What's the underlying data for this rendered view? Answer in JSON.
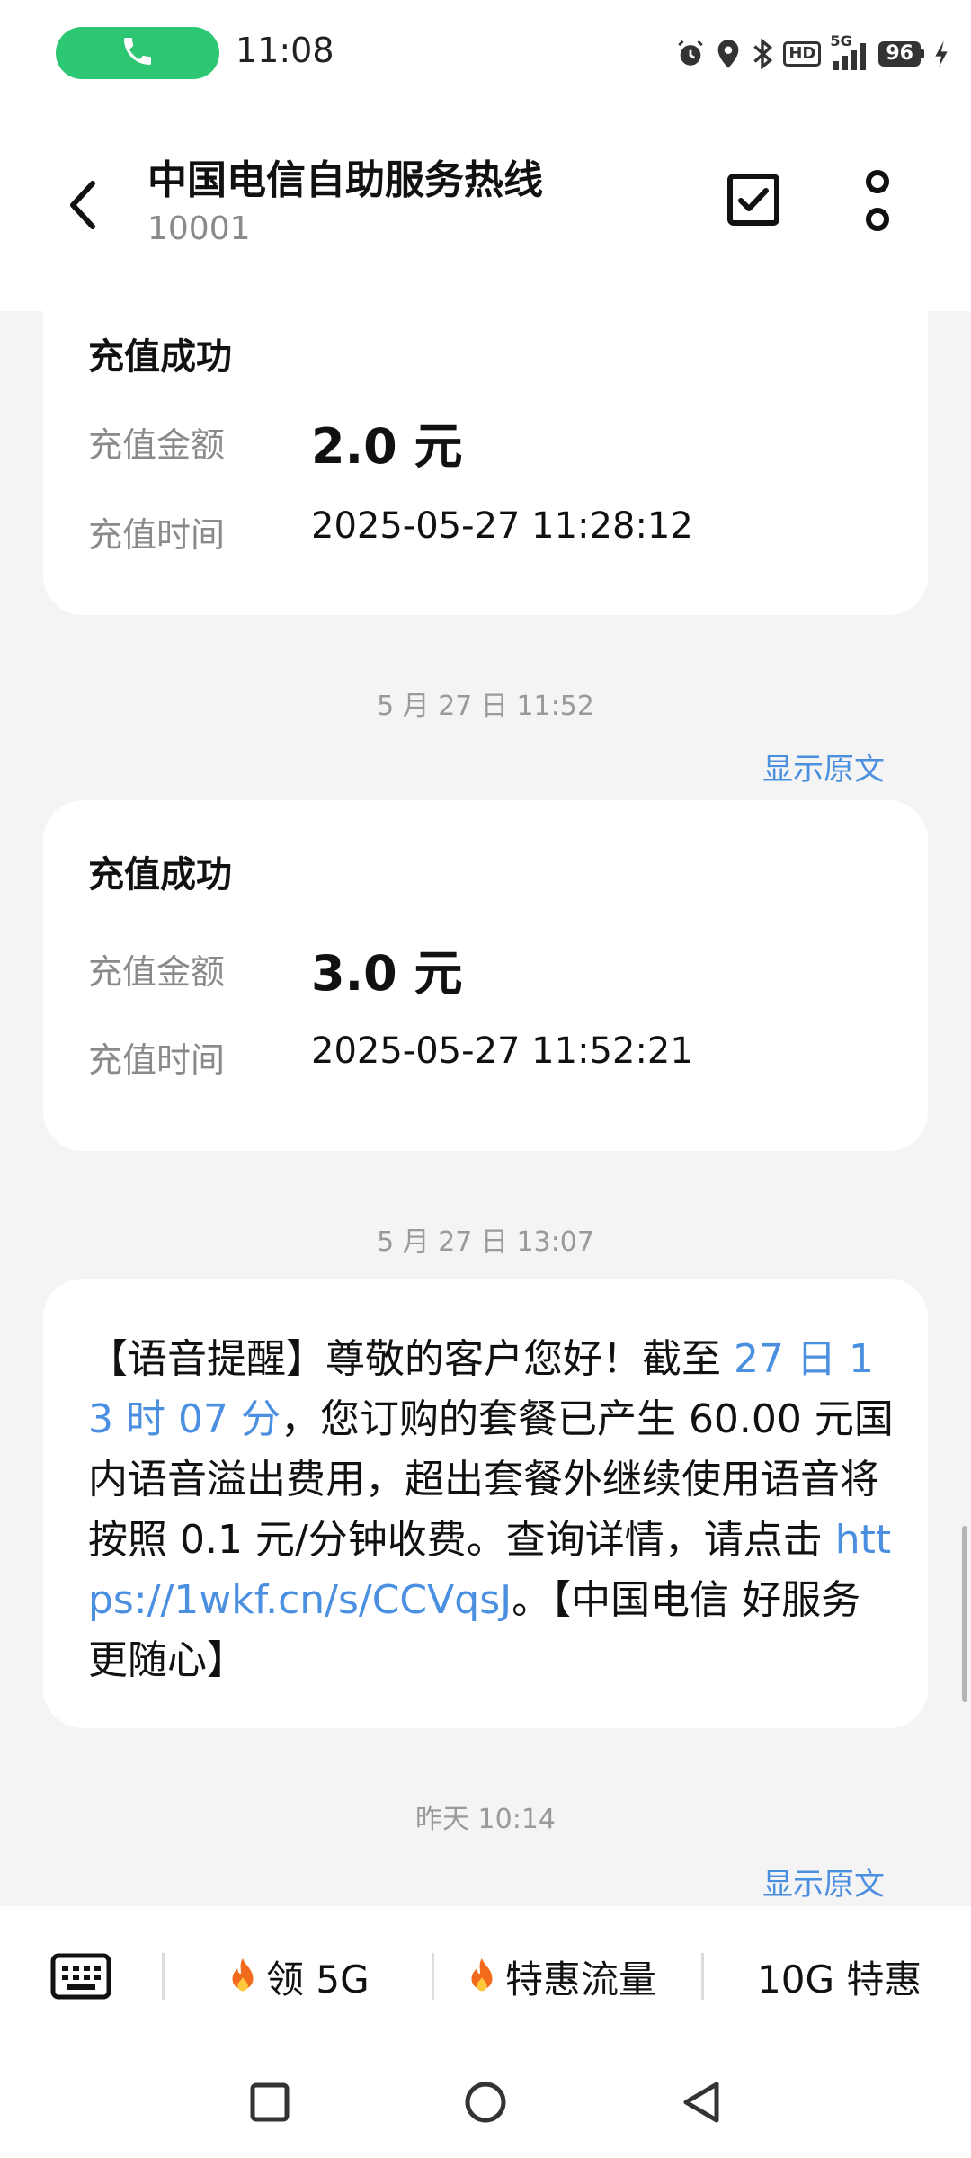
{
  "status_bar": {
    "time": "11:08",
    "network": "5G",
    "battery": "96",
    "hd_label": "HD",
    "icons": [
      "phone-icon",
      "alarm-icon",
      "location-icon",
      "bluetooth-icon",
      "hd-icon",
      "signal-5g-icon",
      "battery-icon",
      "charging-icon"
    ]
  },
  "header": {
    "title": "中国电信自助服务热线",
    "number": "10001"
  },
  "messages": [
    {
      "card_title": "充值成功",
      "amount_label": "充值金额",
      "amount": "2.0 元",
      "time_label": "充值时间",
      "time": "2025-05-27 11:28:12"
    },
    {
      "date": "5 月 27 日 11:52",
      "show_original": "显示原文",
      "card_title": "充值成功",
      "amount_label": "充值金额",
      "amount": "3.0 元",
      "time_label": "充值时间",
      "time": "2025-05-27 11:52:21"
    },
    {
      "date": "5 月 27 日 13:07",
      "text_1": "【语音提醒】尊敬的客户您好！截至 ",
      "time_highlight": "27 日 13 时 07 分",
      "text_2": "，您订购的套餐已产生 60.00 元国内语音溢出费用，超出套餐外继续使用语音将按照 0.1 元/分钟收费。查询详情，请点击 ",
      "link": "https://1wkf.cn/s/CCVqsJ",
      "text_3": "。【中国电信 好服务更随心】"
    },
    {
      "date": "昨天 10:14",
      "show_original": "显示原文"
    }
  ],
  "bottom_bar": {
    "quick_replies": [
      "领 5G",
      "特惠流量",
      "10G 特惠"
    ]
  },
  "colors": {
    "accent": "#4b8fe0",
    "call_green": "#2dc673",
    "background": "#f4f4f4",
    "card": "#ffffff"
  }
}
